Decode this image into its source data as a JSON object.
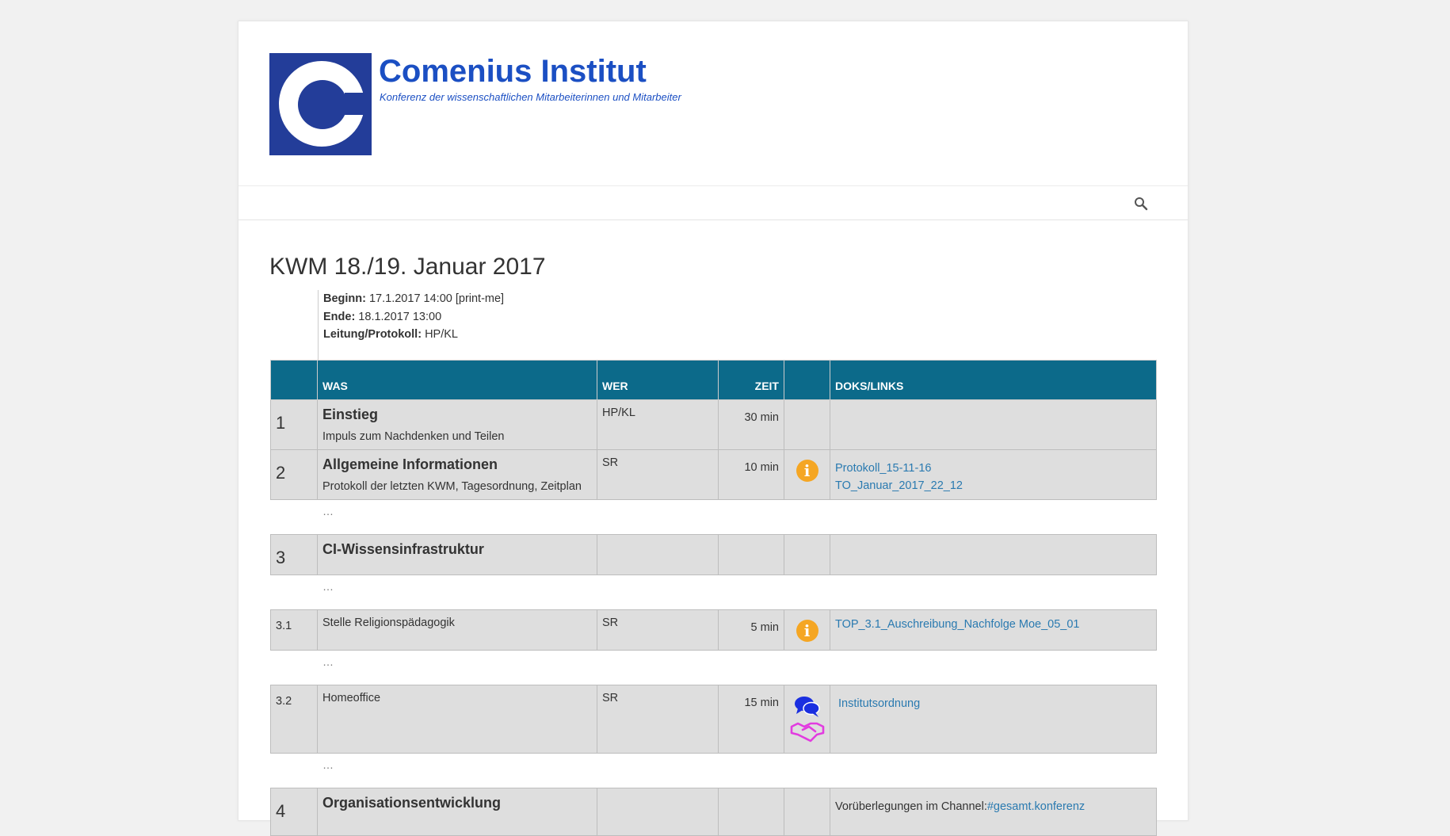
{
  "site": {
    "title": "Comenius Institut",
    "description": "Konferenz der wissenschaftlichen Mitarbeiterinnen und Mitarbeiter"
  },
  "nav": {
    "search_icon": "search-icon"
  },
  "page": {
    "title": "KWM 18./19. Januar 2017",
    "meta": {
      "beginn_label": "Beginn:",
      "beginn_value": " 17.1.2017 14:00 [print-me]",
      "ende_label": "Ende:",
      "ende_value": " 18.1.2017 13:00",
      "leitung_label": "Leitung/Protokoll:",
      "leitung_value": " HP/KL"
    }
  },
  "table": {
    "headers": {
      "num": "",
      "was": "WAS",
      "wer": "WER",
      "zeit": "ZEIT",
      "icon": "",
      "doks": "DOKS/LINKS"
    },
    "ellipsis": "…",
    "rows": [
      {
        "num": "1",
        "title": "Einstieg",
        "sub": "Impuls zum Nachdenken und Teilen",
        "wer": "HP/KL",
        "zeit": "30 min"
      },
      {
        "num": "2",
        "title": "Allgemeine Informationen",
        "sub": "Protokoll der letzten KWM, Tagesordnung, Zeitplan",
        "wer": "SR",
        "zeit": "10 min",
        "icon": "info-icon",
        "links": [
          "Protokoll_15-11-16",
          "TO_Januar_2017_22_12"
        ]
      },
      {
        "num": "3",
        "title": "CI-Wissensinfrastruktur"
      },
      {
        "num": "3.1",
        "text": "Stelle Religionspädagogik",
        "wer": "SR",
        "zeit": "5 min",
        "icon": "info-icon",
        "links": [
          "TOP_3.1_Auschreibung_Nachfolge Moe_05_01"
        ]
      },
      {
        "num": "3.2",
        "text": "Homeoffice",
        "wer": "SR",
        "zeit": "15 min",
        "icons": [
          "chat-bubbles-icon",
          "handshake-icon"
        ],
        "links": [
          "Institutsordnung"
        ]
      },
      {
        "num": "4",
        "title": "Organisationsentwicklung",
        "doks_text": "Vorüberlegungen im Channel:",
        "doks_link": "#gesamt.konferenz"
      }
    ]
  },
  "colors": {
    "header_bg": "#0c6a8a",
    "brand_blue": "#1b4fc3",
    "link": "#2a7ab0",
    "info": "#f5a623",
    "chat": "#1a2fe0",
    "handshake": "#e23ce0"
  }
}
